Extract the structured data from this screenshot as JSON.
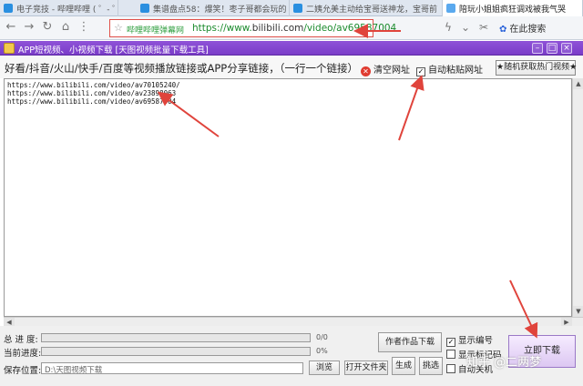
{
  "browser": {
    "tabs": [
      {
        "label": "电子竞技 - 哔哩哔哩 ( ゜- ゜)つロ 干杯~-bili"
      },
      {
        "label": "集谱盘点58：爆笑！枣子哥都会玩的"
      },
      {
        "label": "二姨允美主动给宝哥送神龙，宝哥前"
      },
      {
        "label": "陪玩小姐姐疯狂调戏被我气哭"
      }
    ],
    "address": {
      "site_tag": "哔哩哔哩弹幕网",
      "url_prefix": "https://www.",
      "url_domain": "bilibili.com",
      "url_path": "/video/av69587004"
    },
    "search_label": "在此搜索"
  },
  "app": {
    "title": "APP短视频、小视频下载 [天图视频批量下载工具]",
    "instruction": "好看/抖音/火山/快手/百度等视频播放链接或APP分享链接，（一行一个链接）",
    "clear_label": "清空网址",
    "autopaste_label": "自动粘贴网址",
    "autopaste_checked": true,
    "random_label": "★随机获取热门视频★",
    "urls": [
      "https://www.bilibili.com/video/av70105240/",
      "https://www.bilibili.com/video/av23898063",
      "https://www.bilibili.com/video/av69587004"
    ],
    "total_progress_label": "总 进 度:",
    "total_progress_value": "0/0",
    "current_progress_label": "当前进度:",
    "current_progress_value": "0%",
    "save_label": "保存位置:",
    "save_path": "D:\\天图视频下载",
    "browse_label": "浏览",
    "open_folder_label": "打开文件夹",
    "generate_label": "生成",
    "pick_label": "挑选",
    "author_download_label": "作者作品下载",
    "show_number_label": "显示编号",
    "show_number_checked": true,
    "show_title_label": "显示标记码",
    "show_title_checked": false,
    "auto_off_label": "自动关机",
    "auto_off_checked": false,
    "download_now_label": "立即下载"
  },
  "watermark": "知乎 @二两梦",
  "colors": {
    "title_bar": "#7a3cc8",
    "annotation_arrow": "#e0443c",
    "url_text": "#1a8a2c"
  }
}
